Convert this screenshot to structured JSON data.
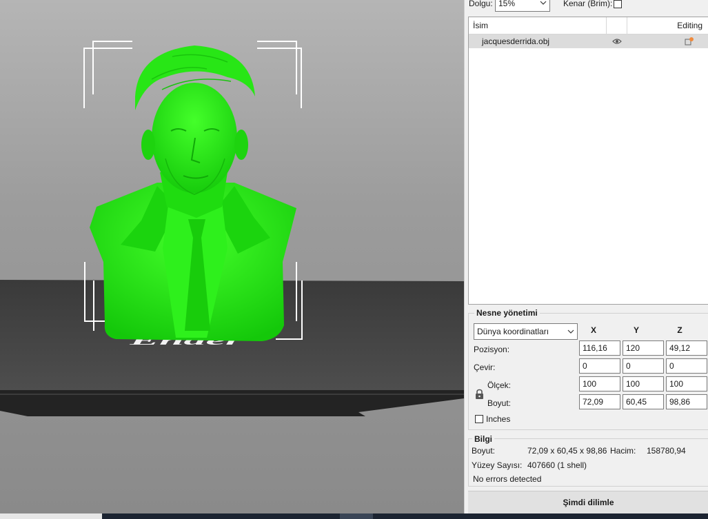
{
  "toolbar": {
    "infill_label": "Dolgu:",
    "infill_value": "15%",
    "brim_label": "Kenar (Brim):"
  },
  "object_list": {
    "col_name": "İsim",
    "col_editing": "Editing",
    "items": [
      {
        "name": "jacquesderrida.obj",
        "visible_icon": "eye-icon",
        "edit_icon": "edit-object-icon"
      }
    ]
  },
  "object_manipulation": {
    "title": "Nesne yönetimi",
    "coord_system": "Dünya koordinatları",
    "axes": [
      "X",
      "Y",
      "Z"
    ],
    "rows": {
      "position": {
        "label": "Pozisyon:",
        "values": [
          "116,16",
          "120",
          "49,12"
        ]
      },
      "rotate": {
        "label": "Çevir:",
        "values": [
          "0",
          "0",
          "0"
        ]
      },
      "scale": {
        "label": "Ölçek:",
        "values": [
          "100",
          "100",
          "100"
        ]
      },
      "size": {
        "label": "Boyut:",
        "values": [
          "72,09",
          "60,45",
          "98,86"
        ]
      }
    },
    "lock_icon": "lock-icon",
    "inches_label": "Inches"
  },
  "info": {
    "title": "Bilgi",
    "size_label": "Boyut:",
    "size_value": "72,09 x 60,45 x 98,86",
    "volume_label": "Hacim:",
    "volume_value": "158780,94",
    "facets_label": "Yüzey Sayısı:",
    "facets_value": "407660 (1 shell)",
    "errors": "No errors detected"
  },
  "slice_button": "Şimdi dilimle",
  "viewport": {
    "model_color": "#22ee11",
    "bed_text": "Ender"
  }
}
